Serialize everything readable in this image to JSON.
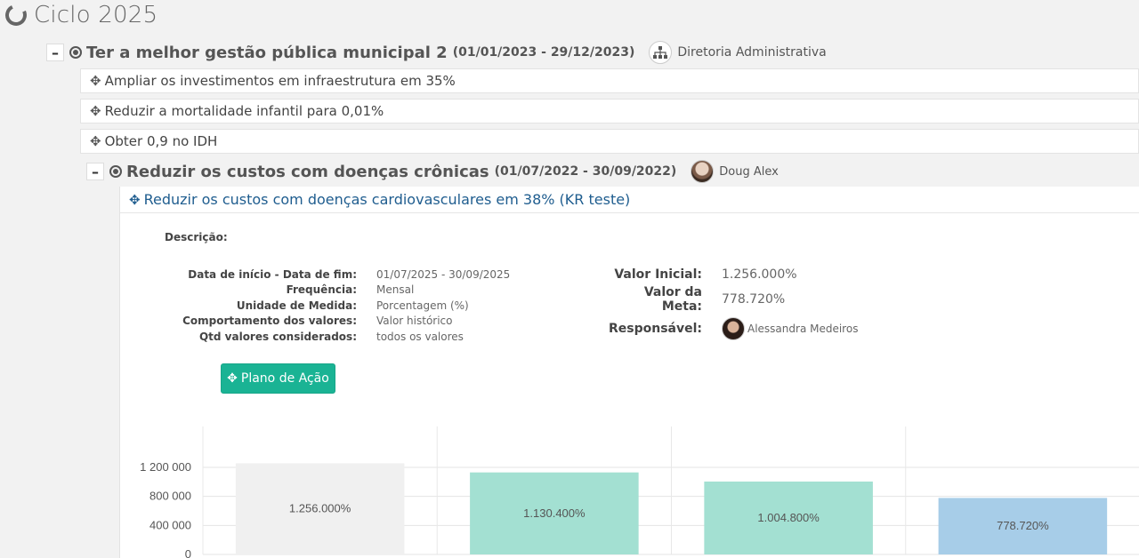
{
  "cycle": {
    "title": "Ciclo 2025"
  },
  "objective1": {
    "title": "Ter a melhor gestão pública municipal 2",
    "dates": "(01/01/2023 - 29/12/2023)",
    "owner": "Diretoria Administrativa",
    "toggle": "–",
    "key_results": [
      {
        "label": "Ampliar os investimentos em infraestrutura em 35%"
      },
      {
        "label": "Reduzir a mortalidade infantil para 0,01%"
      },
      {
        "label": "Obter 0,9 no IDH"
      }
    ]
  },
  "objective2": {
    "title": "Reduzir os custos com doenças crônicas",
    "dates": "(01/07/2022 - 30/09/2022)",
    "owner": "Doug Alex",
    "toggle": "–"
  },
  "kr_detail": {
    "title": "Reduzir os custos com doenças cardiovasculares em 38% (KR teste)",
    "description_label": "Descrição:",
    "info": [
      {
        "label": "Data de início - Data de fim:",
        "value": "01/07/2025 - 30/09/2025"
      },
      {
        "label": "Frequência:",
        "value": "Mensal"
      },
      {
        "label": "Unidade de Medida:",
        "value": "Porcentagem (%)"
      },
      {
        "label": "Comportamento dos valores:",
        "value": "Valor histórico"
      },
      {
        "label": "Qtd valores considerados:",
        "value": "todos os valores"
      }
    ],
    "initial_label": "Valor Inicial:",
    "initial_value": "1.256.000%",
    "target_label": "Valor da Meta:",
    "target_value": "778.720%",
    "responsible_label": "Responsável:",
    "responsible_name": "Alessandra Medeiros",
    "action_button": "Plano de Ação"
  },
  "colors": {
    "accent": "#1ab394",
    "link": "#1f5d8f",
    "bar_initial": "#f0f0f0",
    "bar_progress": "#a3e0d2",
    "bar_target": "#a7cde8"
  },
  "chart_data": {
    "type": "bar",
    "categories": [
      "",
      "",
      "",
      ""
    ],
    "values": [
      1256000,
      1130400,
      1004800,
      778720
    ],
    "labels": [
      "1.256.000%",
      "1.130.400%",
      "1.004.800%",
      "778.720%"
    ],
    "yticks": [
      "0",
      "400 000",
      "800 000",
      "1 200 000"
    ],
    "ytick_values": [
      0,
      400000,
      800000,
      1200000
    ],
    "ylim": [
      0,
      1400000
    ],
    "colors": [
      "#f0f0f0",
      "#a3e0d2",
      "#a3e0d2",
      "#a7cde8"
    ],
    "grid": true
  }
}
